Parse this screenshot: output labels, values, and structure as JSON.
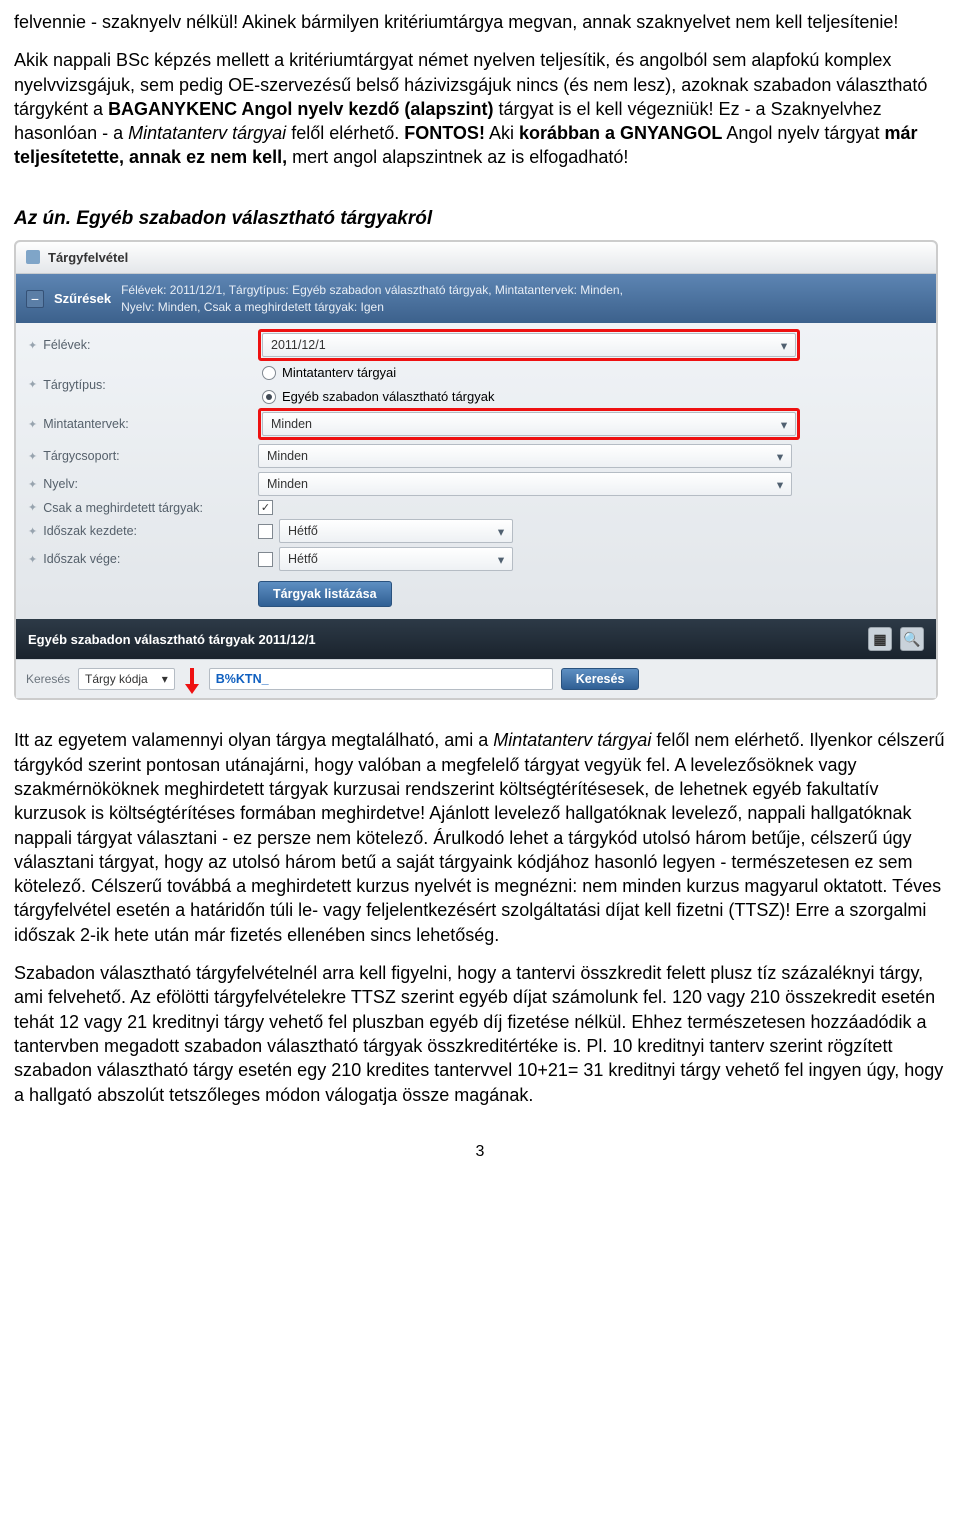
{
  "intro": {
    "p1a": "felvennie - szaknyelv nélkül! Akinek bármilyen kritériumtárgya megvan, annak szaknyelvet nem kell teljesítenie!",
    "p2a": "Akik nappali BSc képzés mellett a kritériumtárgyat német nyelven teljesítik, és angolból sem alapfokú komplex nyelvvizsgájuk, sem pedig OE-szervezésű belső házivizsgájuk nincs (és nem lesz), azoknak szabadon választható tárgyként a ",
    "p2b": "BAGANYKENC Angol nyelv kezdő (alapszint)",
    "p2c": " tárgyat is el kell végezniük! Ez - a Szaknyelvhez hasonlóan - a ",
    "p2d": "Mintatanterv tárgyai",
    "p2e": " felől elérhető. ",
    "p2f": "FONTOS!",
    "p2g": " Aki ",
    "p2h": "korábban a GNYANGOL",
    "p2i": " Angol nyelv tárgyat ",
    "p2j": "már teljesítetette, annak ez nem kell,",
    "p2k": " mert angol alapszintnek az is elfogadható!",
    "subhead": "Az ún. Egyéb szabadon választható tárgyakról"
  },
  "app": {
    "title": "Tárgyfelvétel",
    "filter": {
      "label": "Szűrések",
      "desc1": "Félévek: 2011/12/1, Tárgytípus: Egyéb szabadon választható tárgyak, Mintatantervek: Minden,",
      "desc2": "Nyelv: Minden, Csak a meghirdetett tárgyak: Igen",
      "rows": {
        "felevek": "Félévek:",
        "targytipus": "Tárgytípus:",
        "mintatantervek": "Mintatantervek:",
        "targycsopor": "Tárgycsoport:",
        "nyelv": "Nyelv:",
        "csak": "Csak a meghirdetett tárgyak:",
        "kezdete": "Időszak kezdete:",
        "vege": "Időszak vége:"
      },
      "values": {
        "felevek": "2011/12/1",
        "radio1": "Mintatanterv tárgyai",
        "radio2": "Egyéb szabadon választható tárgyak",
        "mintatantervek": "Minden",
        "targycsopor": "Minden",
        "nyelv": "Minden",
        "kezdete": "Hétfő",
        "vege": "Hétfő"
      },
      "button": "Tárgyak listázása"
    },
    "subjects_header": "Egyéb szabadon választható tárgyak 2011/12/1",
    "search": {
      "k_label": "Keresés",
      "field_select": "Tárgy kódja",
      "typed": "B%KTN_",
      "button": "Keresés"
    }
  },
  "body": {
    "p1a": "Itt az egyetem valamennyi olyan tárgya megtalálható, ami a ",
    "p1b": "Mintatanterv tárgyai",
    "p1c": " felől nem elérhető. Ilyenkor célszerű tárgykód szerint pontosan utánajárni, hogy valóban a megfelelő tárgyat vegyük fel. A levelezősöknek vagy szakmérnököknek meghirdetett tárgyak kurzusai rendszerint költségtérítésesek, de lehetnek egyéb fakultatív kurzusok is költségtérítéses formában meghirdetve! Ajánlott levelező hallgatóknak levelező, nappali hallgatóknak nappali tárgyat választani - ez persze nem kötelező. Árulkodó lehet a tárgykód utolsó három betűje, célszerű úgy választani tárgyat, hogy az utolsó három betű a saját tárgyaink kódjához hasonló legyen - természetesen ez sem kötelező. Célszerű továbbá a meghirdetett kurzus nyelvét is megnézni: nem minden kurzus magyarul oktatott. Téves tárgyfelvétel esetén a határidőn túli le- vagy feljelentkezésért szolgáltatási díjat kell fizetni (TTSZ)! Erre a szorgalmi időszak 2-ik hete után már fizetés ellenében sincs lehetőség.",
    "p2": "Szabadon választható tárgyfelvételnél arra kell figyelni, hogy a tantervi összkredit felett plusz tíz százaléknyi tárgy, ami felvehető. Az efölötti tárgyfelvételekre TTSZ szerint egyéb díjat számolunk fel. 120 vagy 210 összekredit esetén tehát 12 vagy 21 kreditnyi tárgy vehető fel pluszban egyéb díj fizetése nélkül. Ehhez természetesen hozzáadódik a tantervben megadott szabadon választható tárgyak összkreditértéke is. Pl. 10 kreditnyi tanterv szerint rögzített szabadon választható tárgy esetén egy 210 kredites tantervvel 10+21= 31 kreditnyi tárgy vehető fel ingyen úgy, hogy a hallgató abszolút tetszőleges módon válogatja össze magának."
  },
  "page_number": "3"
}
